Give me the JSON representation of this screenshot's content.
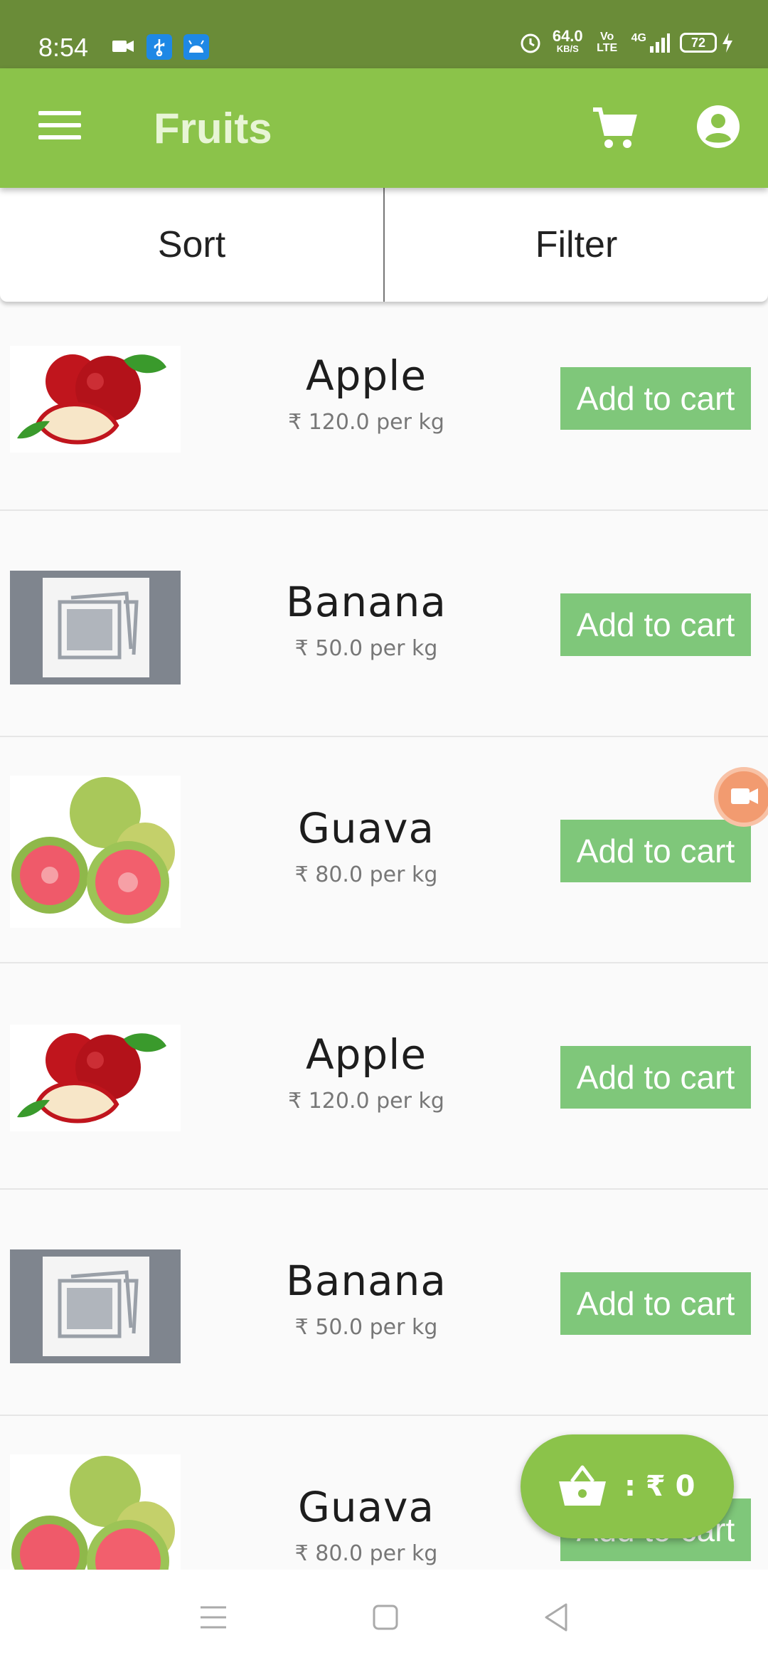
{
  "status_bar": {
    "time": "8:54",
    "net_speed": "64.0",
    "net_speed_unit": "KB/S",
    "volte": "Vo LTE",
    "network": "4G",
    "battery": "72"
  },
  "app_bar": {
    "title": "Fruits"
  },
  "tabs": {
    "sort_label": "Sort",
    "filter_label": "Filter"
  },
  "products": [
    {
      "name": "Apple",
      "price": "₹ 120.0 per kg",
      "button": "Add to cart",
      "image": "apple"
    },
    {
      "name": "Banana",
      "price": "₹ 50.0 per kg",
      "button": "Add to cart",
      "image": "placeholder"
    },
    {
      "name": "Guava",
      "price": "₹ 80.0 per kg",
      "button": "Add to cart",
      "image": "guava"
    },
    {
      "name": "Apple",
      "price": "₹ 120.0 per kg",
      "button": "Add to cart",
      "image": "apple"
    },
    {
      "name": "Banana",
      "price": "₹ 50.0 per kg",
      "button": "Add to cart",
      "image": "placeholder"
    },
    {
      "name": "Guava",
      "price": "₹ 80.0 per kg",
      "button": "Add to cart",
      "image": "guava"
    }
  ],
  "cart_total": {
    "label": ": ₹ 0",
    "icon": "basket-icon"
  },
  "colors": {
    "status_bar": "#6a8c38",
    "app_bar": "#8bc34a",
    "add_button": "#7fc77a"
  }
}
